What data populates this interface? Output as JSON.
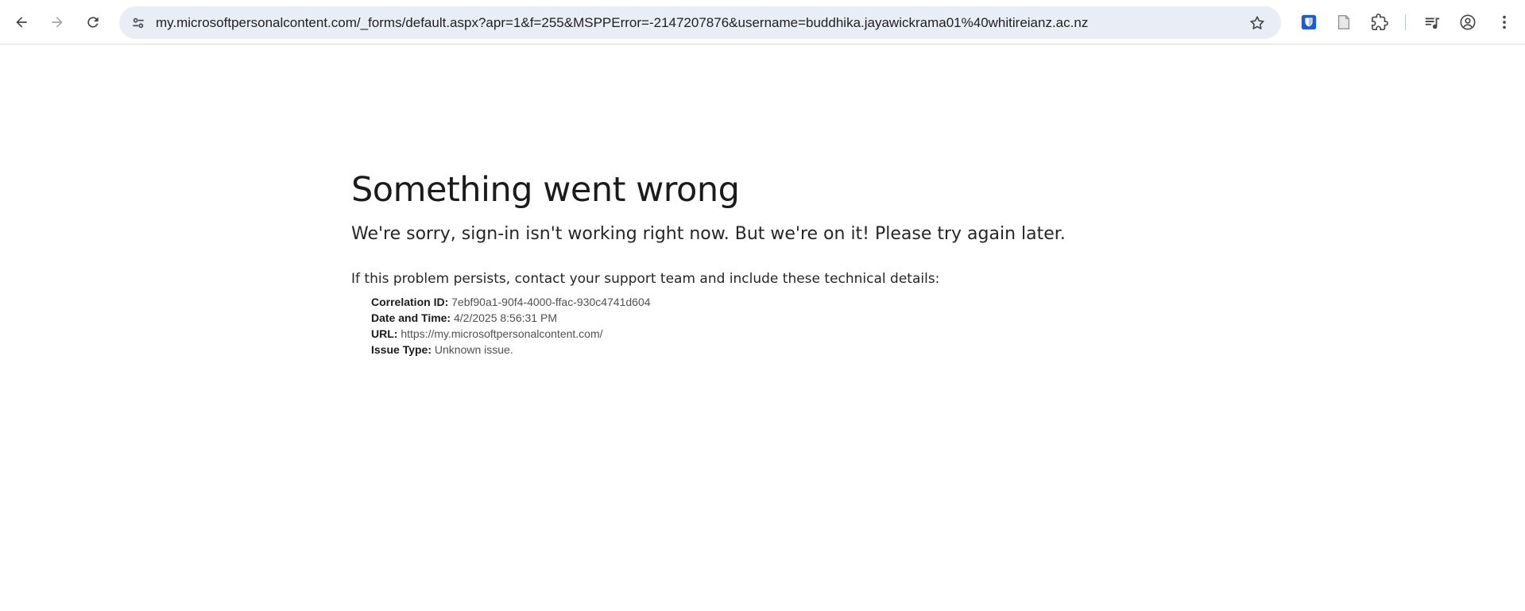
{
  "browser": {
    "url": "my.microsoftpersonalcontent.com/_forms/default.aspx?apr=1&f=255&MSPPError=-2147207876&username=buddhika.jayawickrama01%40whitireianz.ac.nz",
    "icons": {
      "back": "back-arrow-icon",
      "forward": "forward-arrow-icon",
      "reload": "reload-icon",
      "site_info": "tune-icon",
      "bookmark": "star-icon",
      "extension_1": "bitwarden-shield-icon",
      "extension_2": "document-icon",
      "extensions": "puzzle-icon",
      "media": "media-queue-icon",
      "profile": "account-circle-icon",
      "menu": "kebab-menu-icon"
    }
  },
  "error": {
    "title": "Something went wrong",
    "message": "We're sorry, sign-in isn't working right now. But we're on it! Please try again later.",
    "persist_text": "If this problem persists, contact your support team and include these technical details:",
    "details": [
      {
        "label": "Correlation ID:",
        "value": "7ebf90a1-90f4-4000-ffac-930c4741d604"
      },
      {
        "label": "Date and Time:",
        "value": "4/2/2025 8:56:31 PM"
      },
      {
        "label": "URL:",
        "value": "https://my.microsoftpersonalcontent.com/"
      },
      {
        "label": "Issue Type:",
        "value": "Unknown issue."
      }
    ]
  },
  "colors": {
    "accent": "#0b57d0",
    "omnibox": "#e9eef6"
  }
}
